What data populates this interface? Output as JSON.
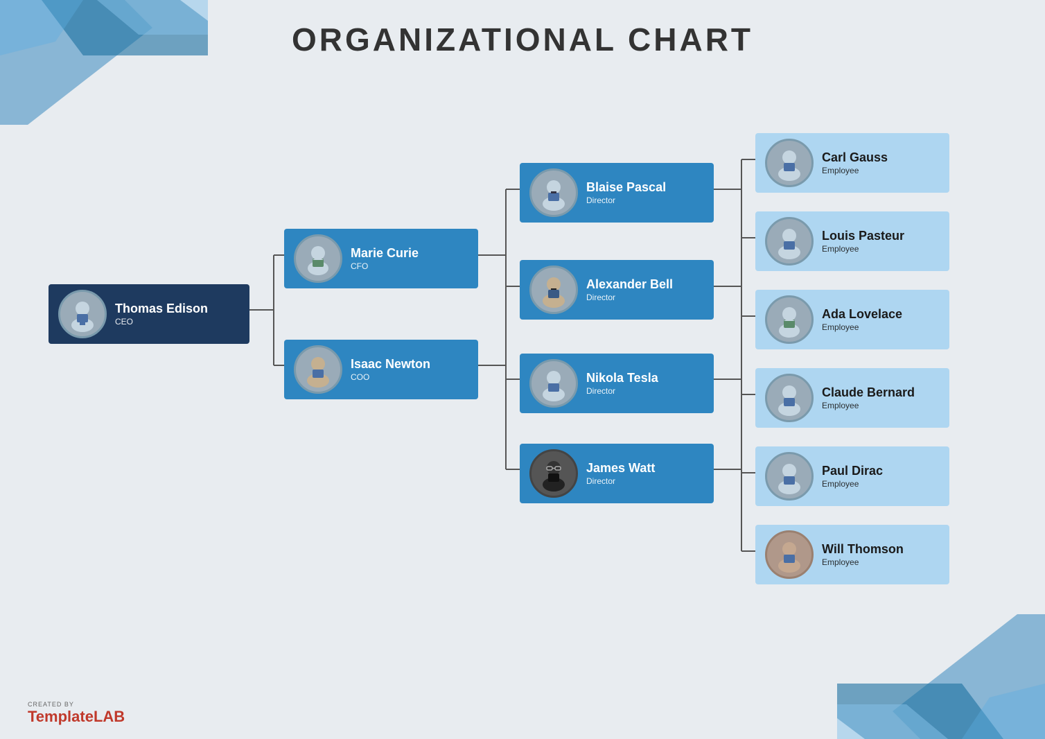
{
  "title": "ORGANIZATIONAL CHART",
  "nodes": {
    "ceo": {
      "name": "Thomas Edison",
      "role": "CEO",
      "style": "dark"
    },
    "cfo": {
      "name": "Marie Curie",
      "role": "CFO",
      "style": "blue"
    },
    "coo": {
      "name": "Isaac Newton",
      "role": "COO",
      "style": "blue"
    },
    "pascal": {
      "name": "Blaise Pascal",
      "role": "Director",
      "style": "blue"
    },
    "bell": {
      "name": "Alexander Bell",
      "role": "Director",
      "style": "blue"
    },
    "tesla": {
      "name": "Nikola Tesla",
      "role": "Director",
      "style": "blue"
    },
    "watt": {
      "name": "James Watt",
      "role": "Director",
      "style": "blue"
    },
    "gauss": {
      "name": "Carl Gauss",
      "role": "Employee",
      "style": "light"
    },
    "pasteur": {
      "name": "Louis Pasteur",
      "role": "Employee",
      "style": "light"
    },
    "lovelace": {
      "name": "Ada Lovelace",
      "role": "Employee",
      "style": "light"
    },
    "bernard": {
      "name": "Claude Bernard",
      "role": "Employee",
      "style": "light"
    },
    "dirac": {
      "name": "Paul Dirac",
      "role": "Employee",
      "style": "light"
    },
    "thomson": {
      "name": "Will Thomson",
      "role": "Employee",
      "style": "light"
    }
  },
  "watermark": {
    "created_by": "CREATED BY",
    "brand_normal": "Template",
    "brand_bold": "LAB"
  }
}
